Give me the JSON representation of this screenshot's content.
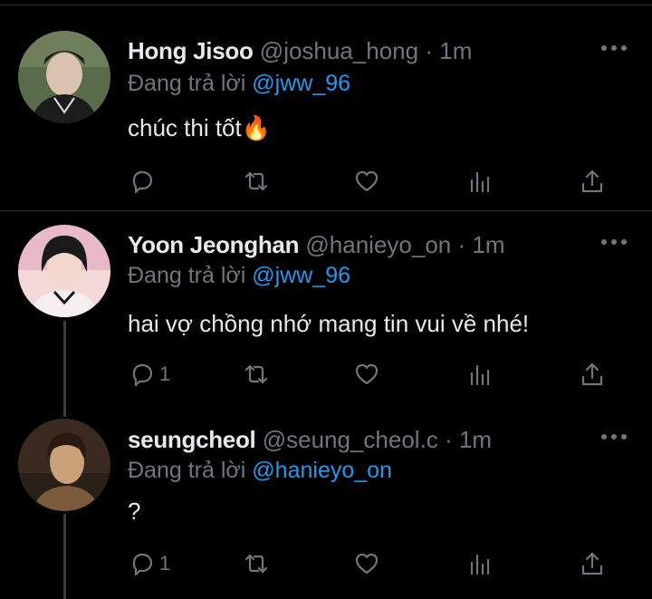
{
  "tweets": [
    {
      "name": "Hong Jisoo",
      "handle": "@joshua_hong",
      "sep": "·",
      "time": "1m",
      "reply_prefix": "Đang trả lời",
      "reply_to": "@jww_96",
      "text": "chúc thi tốt",
      "emoji": "🔥",
      "reply_count": "",
      "avatar_colors": [
        "#5a6b4a",
        "#1c1c1c",
        "#d9c3b0"
      ]
    },
    {
      "name": "Yoon Jeonghan",
      "handle": "@hanieyo_on",
      "sep": "·",
      "time": "1m",
      "reply_prefix": "Đang trả lời",
      "reply_to": "@jww_96",
      "text": "hai vợ chồng nhớ mang tin vui về nhé!",
      "emoji": "",
      "reply_count": "1",
      "avatar_colors": [
        "#e8b9c8",
        "#1a1a1a",
        "#f4d9d9"
      ]
    },
    {
      "name": "seungcheol",
      "handle": "@seung_cheol.c",
      "sep": "·",
      "time": "1m",
      "reply_prefix": "Đang trả lời",
      "reply_to": "@hanieyo_on",
      "text": "?",
      "emoji": "",
      "reply_count": "1",
      "avatar_colors": [
        "#3b2a1f",
        "#7a5a3a",
        "#c9a27a"
      ]
    }
  ],
  "icons": {
    "reply": "reply-icon",
    "retweet": "retweet-icon",
    "like": "like-icon",
    "views": "views-icon",
    "share": "share-icon",
    "more": "more-icon"
  },
  "colors": {
    "background": "#000000",
    "text": "#e7e9ea",
    "secondary": "#71767b",
    "mention": "#1d9bf0",
    "divider": "#2f3336"
  }
}
